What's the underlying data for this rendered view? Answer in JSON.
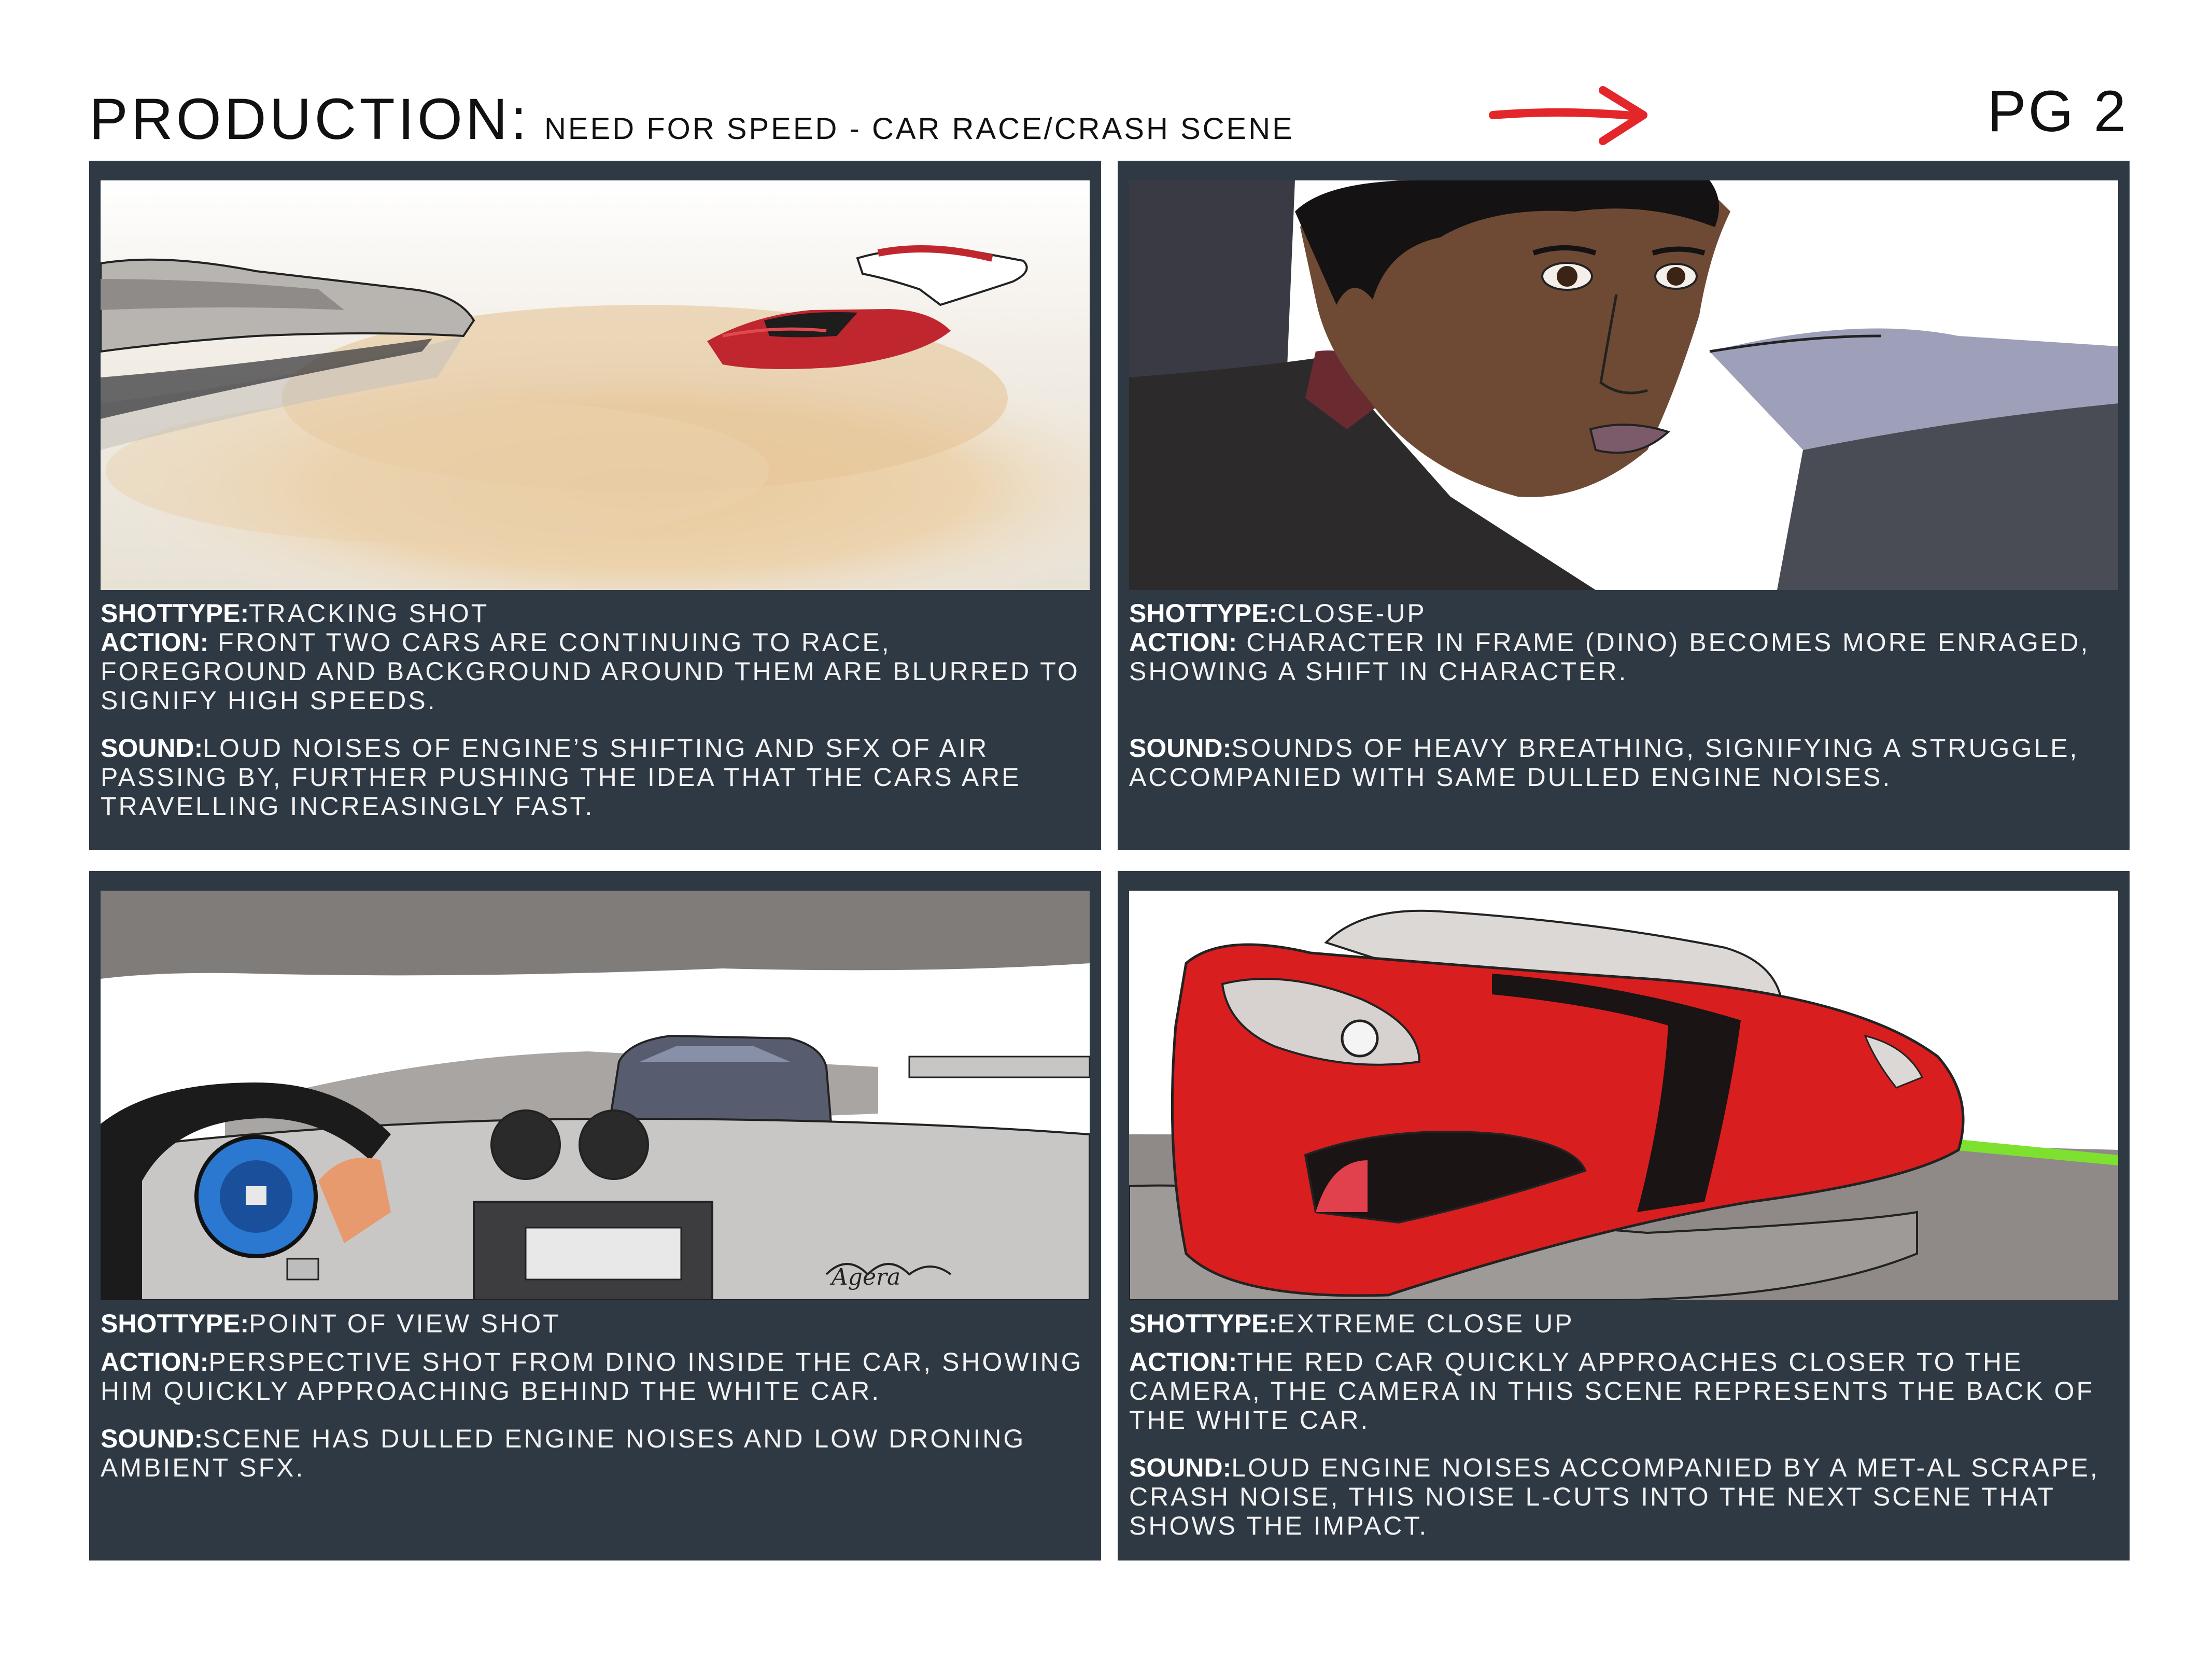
{
  "header": {
    "production_label": "PRODUCTION:",
    "production_title": "NEED FOR SPEED - CAR RACE/CRASH SCENE",
    "page_number": "PG 2"
  },
  "panels": [
    {
      "shot_type_label": "SHOTTYPE:",
      "shot_type": "TRACKING SHOT",
      "action_label": "ACTION:",
      "action": "FRONT TWO CARS ARE CONTINUING TO RACE, FOREGROUND AND BACKGROUND AROUND THEM ARE BLURRED TO SIGNIFY HIGH SPEEDS.",
      "sound_label": "SOUND:",
      "sound": "LOUD NOISES OF ENGINE’S SHIFTING AND SFX OF AIR PASSING BY, FURTHER PUSHING THE IDEA THAT THE CARS ARE TRAVELLING INCREASINGLY FAST."
    },
    {
      "shot_type_label": "SHOTTYPE:",
      "shot_type": "CLOSE-UP",
      "action_label": "ACTION:",
      "action": "CHARACTER IN FRAME (DINO) BECOMES MORE ENRAGED, SHOWING A SHIFT IN CHARACTER.",
      "sound_label": "SOUND:",
      "sound": "SOUNDS OF HEAVY BREATHING, SIGNIFYING A STRUGGLE, ACCOMPANIED WITH SAME DULLED ENGINE NOISES."
    },
    {
      "shot_type_label": "SHOTTYPE:",
      "shot_type": "POINT OF VIEW SHOT",
      "action_label": "ACTION:",
      "action": "PERSPECTIVE SHOT FROM DINO INSIDE THE CAR, SHOWING HIM QUICKLY APPROACHING BEHIND THE WHITE CAR.",
      "sound_label": "SOUND:",
      "sound": "SCENE HAS DULLED ENGINE NOISES AND LOW DRONING AMBIENT SFX.",
      "dashboard_signature": "Agera"
    },
    {
      "shot_type_label": "SHOTTYPE:",
      "shot_type": "EXTREME CLOSE UP",
      "action_label": "ACTION:",
      "action": "THE RED CAR QUICKLY APPROACHES CLOSER TO THE CAMERA, THE CAMERA IN THIS SCENE REPRESENTS THE BACK OF THE WHITE CAR.",
      "sound_label": "SOUND:",
      "sound": "LOUD ENGINE NOISES ACCOMPANIED BY A MET-AL SCRAPE, CRASH NOISE, THIS NOISE L-CUTS INTO THE NEXT SCENE THAT SHOWS THE IMPACT."
    }
  ],
  "colors": {
    "panel_bg": "#2f3944",
    "arrow": "#e3262a",
    "red_car": "#d81e1e"
  },
  "icons": {
    "direction_arrow": "arrow-right-icon"
  }
}
